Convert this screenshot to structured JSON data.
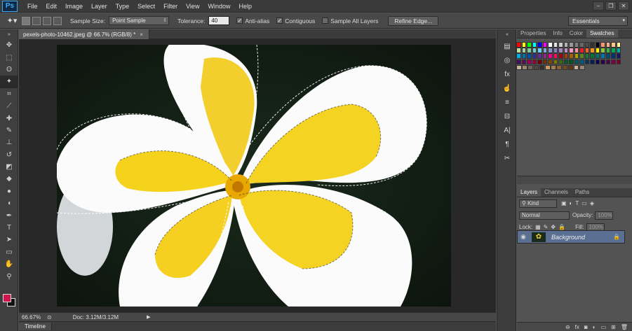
{
  "app": {
    "logo": "Ps"
  },
  "menu": [
    "File",
    "Edit",
    "Image",
    "Layer",
    "Type",
    "Select",
    "Filter",
    "View",
    "Window",
    "Help"
  ],
  "window_buttons": [
    "–",
    "❐",
    "✕"
  ],
  "options": {
    "sample_size_label": "Sample Size:",
    "sample_size_value": "Point Sample",
    "tolerance_label": "Tolerance:",
    "tolerance_value": "40",
    "anti_alias": "Anti-alias",
    "contiguous": "Contiguous",
    "sample_all_layers": "Sample All Layers",
    "refine_edge": "Refine Edge...",
    "workspace": "Essentials"
  },
  "document": {
    "tab_title": "pexels-photo-10462.jpeg @ 66.7% (RGB/8) *",
    "close": "×",
    "zoom": "66.67%",
    "doc_size": "Doc: 3.12M/3.12M"
  },
  "timeline": {
    "label": "Timeline"
  },
  "swatches_panel": {
    "tabs": [
      "Properties",
      "Info",
      "Color",
      "Swatches"
    ],
    "active_tab": "Swatches"
  },
  "layers_panel": {
    "tabs": [
      "Layers",
      "Channels",
      "Paths"
    ],
    "active_tab": "Layers",
    "filter": "Kind",
    "blend_mode": "Normal",
    "opacity_label": "Opacity:",
    "opacity_value": "100%",
    "lock_label": "Lock:",
    "fill_label": "Fill:",
    "fill_value": "100%",
    "layers": [
      {
        "name": "Background",
        "visible": true,
        "locked": true
      }
    ]
  },
  "colors": {
    "foreground": "#d0164d",
    "background": "#111111",
    "layer_selected": "#5a6f92"
  }
}
